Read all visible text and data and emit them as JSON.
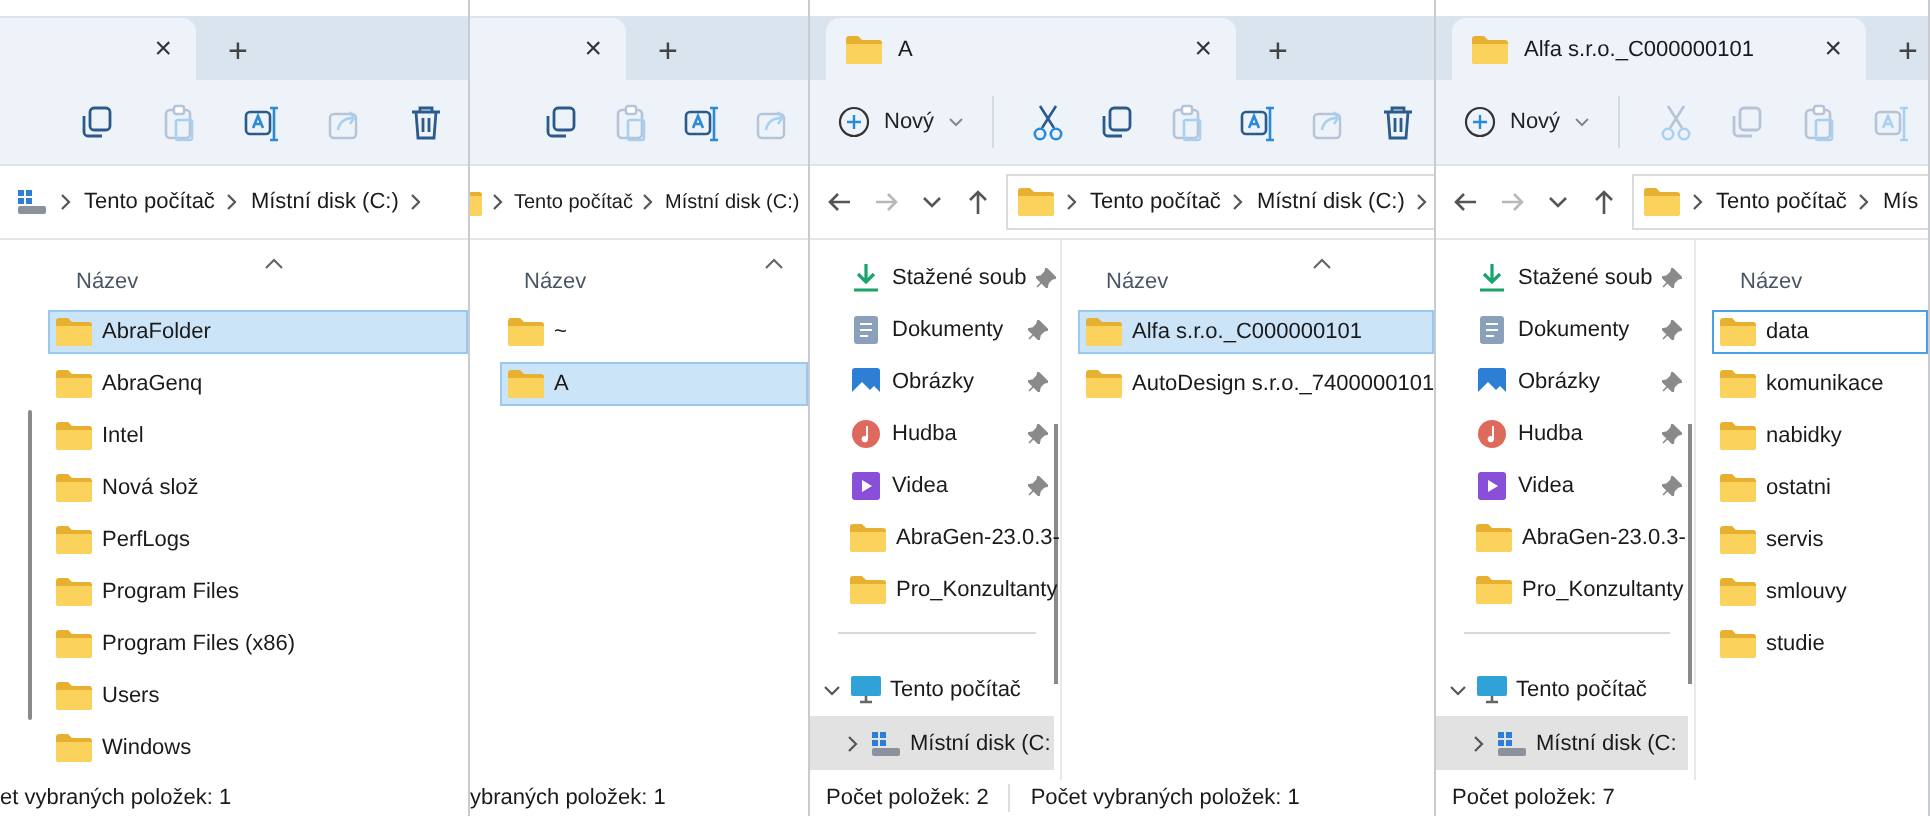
{
  "panes": [
    {
      "tab": {
        "close": "×",
        "new_tab": "+"
      },
      "toolbar": {
        "tools": [
          {
            "kind": "copy",
            "disabled": false
          },
          {
            "kind": "paste",
            "disabled": true
          },
          {
            "kind": "rename",
            "disabled": false
          },
          {
            "kind": "share",
            "disabled": true
          },
          {
            "kind": "delete",
            "disabled": false
          }
        ]
      },
      "address": {
        "root": {
          "kind": "drive"
        },
        "parts": [
          "Tento počítač",
          "Místní disk (C:)"
        ],
        "trailing_separator": true
      },
      "column": "Název",
      "files": [
        {
          "name": "AbraFolder",
          "selected": true,
          "focused": false
        },
        {
          "name": "AbraGenq",
          "selected": false,
          "focused": false
        },
        {
          "name": "Intel",
          "selected": false,
          "focused": false
        },
        {
          "name": "Nová slož",
          "selected": false,
          "focused": false
        },
        {
          "name": "PerfLogs",
          "selected": false,
          "focused": false
        },
        {
          "name": "Program Files",
          "selected": false,
          "focused": false
        },
        {
          "name": "Program Files (x86)",
          "selected": false,
          "focused": false
        },
        {
          "name": "Users",
          "selected": false,
          "focused": false
        },
        {
          "name": "Windows",
          "selected": false,
          "focused": false
        }
      ],
      "status": [
        "et vybraných položek: 1"
      ]
    },
    {
      "tab": {
        "close": "×",
        "new_tab": "+"
      },
      "toolbar": {
        "tools": [
          {
            "kind": "copy",
            "disabled": false
          },
          {
            "kind": "paste",
            "disabled": true
          },
          {
            "kind": "rename",
            "disabled": false
          },
          {
            "kind": "share",
            "disabled": true
          }
        ]
      },
      "address": {
        "root": {
          "kind": "folder"
        },
        "parts": [
          "Tento počítač",
          "Místní disk (C:)"
        ],
        "trailing_separator": false
      },
      "column": "Název",
      "files": [
        {
          "name": "~",
          "selected": false,
          "focused": false
        },
        {
          "name": "A",
          "selected": true,
          "focused": false
        }
      ],
      "status": [
        "ybraných položek: 1"
      ]
    },
    {
      "tab": {
        "title": "A",
        "close": "×",
        "new_tab": "+"
      },
      "toolbar": {
        "new_button": "Nový",
        "tools": [
          {
            "kind": "cut",
            "disabled": false
          },
          {
            "kind": "copy",
            "disabled": false
          },
          {
            "kind": "paste",
            "disabled": true
          },
          {
            "kind": "rename",
            "disabled": false
          },
          {
            "kind": "share",
            "disabled": true
          },
          {
            "kind": "delete",
            "disabled": false
          }
        ]
      },
      "nav": [
        {
          "kind": "back",
          "disabled": false
        },
        {
          "kind": "forward",
          "disabled": true
        },
        {
          "kind": "recent",
          "disabled": false
        },
        {
          "kind": "up",
          "disabled": false
        }
      ],
      "address": {
        "root": {
          "kind": "folder"
        },
        "parts": [
          "Tento počítač",
          "Místní disk (C:)"
        ],
        "trailing_separator": true
      },
      "sidebar": {
        "quick_access": [
          {
            "label": "Stažené soub",
            "kind": "downloads",
            "pinned": true
          },
          {
            "label": "Dokumenty",
            "kind": "documents",
            "pinned": true
          },
          {
            "label": "Obrázky",
            "kind": "pictures",
            "pinned": true
          },
          {
            "label": "Hudba",
            "kind": "music",
            "pinned": true
          },
          {
            "label": "Videa",
            "kind": "videos",
            "pinned": true
          },
          {
            "label": "AbraGen-23.0.3-",
            "kind": "folder",
            "pinned": false
          },
          {
            "label": "Pro_Konzultanty",
            "kind": "folder",
            "pinned": false
          }
        ],
        "tree": [
          {
            "label": "Tento počítač",
            "kind": "computer",
            "expanded": true,
            "selected": false,
            "children": [
              {
                "label": "Místní disk (C:",
                "kind": "drive",
                "expanded": false,
                "selected": true
              }
            ]
          }
        ]
      },
      "column": "Název",
      "files": [
        {
          "name": "Alfa s.r.o._C000000101",
          "selected": true,
          "focused": false
        },
        {
          "name": "AutoDesign s.r.o._7400000101",
          "selected": false,
          "focused": false
        }
      ],
      "status": [
        "Počet položek: 2",
        "Počet vybraných položek: 1"
      ]
    },
    {
      "tab": {
        "title": "Alfa s.r.o._C000000101",
        "close": "×",
        "new_tab": "+"
      },
      "toolbar": {
        "new_button": "Nový",
        "tools": [
          {
            "kind": "cut",
            "disabled": true
          },
          {
            "kind": "copy",
            "disabled": true
          },
          {
            "kind": "paste",
            "disabled": true
          },
          {
            "kind": "rename",
            "disabled": true
          }
        ]
      },
      "nav": [
        {
          "kind": "back",
          "disabled": false
        },
        {
          "kind": "forward",
          "disabled": true
        },
        {
          "kind": "recent",
          "disabled": false
        },
        {
          "kind": "up",
          "disabled": false
        }
      ],
      "address": {
        "root": {
          "kind": "folder"
        },
        "parts": [
          "Tento počítač",
          "Mís"
        ],
        "trailing_separator": false
      },
      "sidebar": {
        "quick_access": [
          {
            "label": "Stažené soub",
            "kind": "downloads",
            "pinned": true
          },
          {
            "label": "Dokumenty",
            "kind": "documents",
            "pinned": true
          },
          {
            "label": "Obrázky",
            "kind": "pictures",
            "pinned": true
          },
          {
            "label": "Hudba",
            "kind": "music",
            "pinned": true
          },
          {
            "label": "Videa",
            "kind": "videos",
            "pinned": true
          },
          {
            "label": "AbraGen-23.0.3-",
            "kind": "folder",
            "pinned": false
          },
          {
            "label": "Pro_Konzultanty",
            "kind": "folder",
            "pinned": false
          }
        ],
        "tree": [
          {
            "label": "Tento počítač",
            "kind": "computer",
            "expanded": true,
            "selected": false,
            "children": [
              {
                "label": "Místní disk (C:",
                "kind": "drive",
                "expanded": false,
                "selected": true
              }
            ]
          }
        ]
      },
      "column": "Název",
      "files": [
        {
          "name": "data",
          "selected": false,
          "focused": true
        },
        {
          "name": "komunikace",
          "selected": false,
          "focused": false
        },
        {
          "name": "nabidky",
          "selected": false,
          "focused": false
        },
        {
          "name": "ostatni",
          "selected": false,
          "focused": false
        },
        {
          "name": "servis",
          "selected": false,
          "focused": false
        },
        {
          "name": "smlouvy",
          "selected": false,
          "focused": false
        },
        {
          "name": "studie",
          "selected": false,
          "focused": false
        }
      ],
      "status": [
        "Počet položek: 7"
      ]
    }
  ]
}
